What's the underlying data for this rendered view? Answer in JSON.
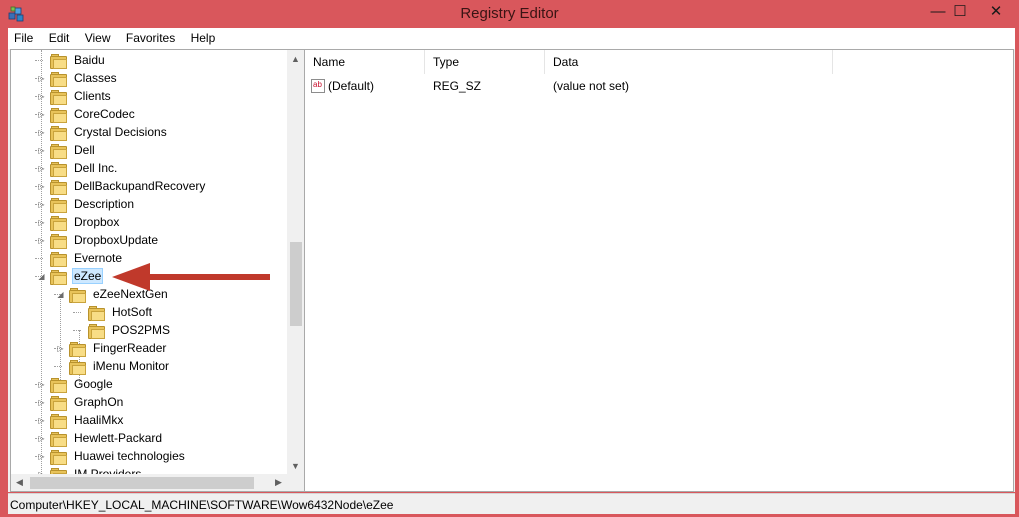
{
  "window": {
    "title": "Registry Editor",
    "minimize": "—",
    "maximize": "☐",
    "close": "✕"
  },
  "menu": [
    "File",
    "Edit",
    "View",
    "Favorites",
    "Help"
  ],
  "tree": [
    {
      "label": "Baidu",
      "expander": ""
    },
    {
      "label": "Classes",
      "expander": "▷"
    },
    {
      "label": "Clients",
      "expander": "▷"
    },
    {
      "label": "CoreCodec",
      "expander": "▷"
    },
    {
      "label": "Crystal Decisions",
      "expander": "▷"
    },
    {
      "label": "Dell",
      "expander": "▷"
    },
    {
      "label": "Dell Inc.",
      "expander": "▷"
    },
    {
      "label": "DellBackupandRecovery",
      "expander": "▷"
    },
    {
      "label": "Description",
      "expander": "▷"
    },
    {
      "label": "Dropbox",
      "expander": "▷"
    },
    {
      "label": "DropboxUpdate",
      "expander": "▷"
    },
    {
      "label": "Evernote",
      "expander": ""
    },
    {
      "label": "eZee",
      "expander": "◢",
      "selected": true
    },
    {
      "label": "eZeeNextGen",
      "expander": "◢"
    },
    {
      "label": "HotSoft",
      "expander": ""
    },
    {
      "label": "POS2PMS",
      "expander": ""
    },
    {
      "label": "FingerReader",
      "expander": "▷"
    },
    {
      "label": "iMenu Monitor",
      "expander": ""
    },
    {
      "label": "Google",
      "expander": "▷"
    },
    {
      "label": "GraphOn",
      "expander": "▷"
    },
    {
      "label": "HaaliMkx",
      "expander": "▷"
    },
    {
      "label": "Hewlett-Packard",
      "expander": "▷"
    },
    {
      "label": "Huawei technologies",
      "expander": "▷"
    },
    {
      "label": "IM Providers",
      "expander": "▷"
    }
  ],
  "list": {
    "columns": [
      "Name",
      "Type",
      "Data"
    ],
    "rows": [
      {
        "name": "(Default)",
        "type": "REG_SZ",
        "data": "(value not set)",
        "icon": "ab"
      }
    ]
  },
  "status": {
    "path": "Computer\\HKEY_LOCAL_MACHINE\\SOFTWARE\\Wow6432Node\\eZee"
  },
  "annotation": {
    "arrow_color": "#c0392b"
  }
}
